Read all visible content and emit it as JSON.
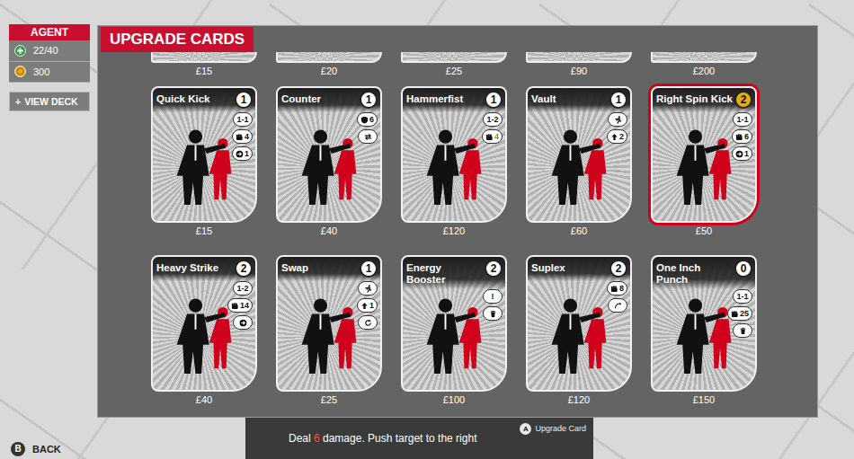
{
  "agent": {
    "title": "AGENT",
    "health": "22/40",
    "money": "300"
  },
  "view_deck": {
    "icon": "+",
    "label": "VIEW DECK"
  },
  "panel": {
    "title": "UPGRADE CARDS"
  },
  "partial_cards": [
    {
      "price": "£15"
    },
    {
      "price": "£20"
    },
    {
      "price": "£25"
    },
    {
      "price": "£90"
    },
    {
      "price": "£200"
    }
  ],
  "cards": [
    {
      "name": "Quick Kick",
      "cost": "1",
      "cost_upgraded": false,
      "price": "£15",
      "selected": false,
      "stats": [
        {
          "kind": "range",
          "value": "1-1",
          "upgraded": false
        },
        {
          "kind": "damage",
          "value": "4",
          "upgraded": false
        },
        {
          "kind": "push",
          "value": "1",
          "upgraded": false
        }
      ]
    },
    {
      "name": "Counter",
      "cost": "1",
      "cost_upgraded": false,
      "price": "£40",
      "selected": false,
      "stats": [
        {
          "kind": "block",
          "value": "6",
          "upgraded": false
        },
        {
          "kind": "swap"
        }
      ]
    },
    {
      "name": "Hammerfist",
      "cost": "1",
      "cost_upgraded": false,
      "price": "£120",
      "selected": false,
      "stats": [
        {
          "kind": "range",
          "value": "1-2",
          "upgraded": false
        },
        {
          "kind": "damage",
          "value": "4",
          "upgraded": true
        }
      ]
    },
    {
      "name": "Vault",
      "cost": "1",
      "cost_upgraded": false,
      "price": "£60",
      "selected": false,
      "stats": [
        {
          "kind": "move"
        },
        {
          "kind": "up",
          "value": "2",
          "upgraded": false
        }
      ]
    },
    {
      "name": "Right Spin Kick",
      "cost": "2",
      "cost_upgraded": true,
      "price": "£50",
      "selected": true,
      "stats": [
        {
          "kind": "range",
          "value": "1-1",
          "upgraded": false
        },
        {
          "kind": "damage",
          "value": "6",
          "upgraded": false
        },
        {
          "kind": "push",
          "value": "1",
          "upgraded": false
        }
      ]
    },
    {
      "name": "Heavy Strike",
      "cost": "2",
      "cost_upgraded": false,
      "price": "£40",
      "selected": false,
      "stats": [
        {
          "kind": "range",
          "value": "1-2",
          "upgraded": false
        },
        {
          "kind": "damage",
          "value": "14",
          "upgraded": false
        },
        {
          "kind": "push"
        }
      ]
    },
    {
      "name": "Swap",
      "cost": "1",
      "cost_upgraded": false,
      "price": "£25",
      "selected": false,
      "stats": [
        {
          "kind": "move"
        },
        {
          "kind": "up",
          "value": "1",
          "upgraded": false
        },
        {
          "kind": "rotate"
        }
      ]
    },
    {
      "name": "Energy Booster",
      "cost": "2",
      "cost_upgraded": false,
      "price": "£100",
      "selected": false,
      "stats": [
        {
          "kind": "text",
          "value": "!",
          "upgraded": false
        },
        {
          "kind": "exhaust"
        }
      ]
    },
    {
      "name": "Suplex",
      "cost": "2",
      "cost_upgraded": false,
      "price": "£120",
      "selected": false,
      "stats": [
        {
          "kind": "damage",
          "value": "8",
          "upgraded": false
        },
        {
          "kind": "throw"
        }
      ]
    },
    {
      "name": "One Inch Punch",
      "cost": "0",
      "cost_upgraded": false,
      "price": "£150",
      "selected": false,
      "stats": [
        {
          "kind": "range",
          "value": "1-1",
          "upgraded": false
        },
        {
          "kind": "damage",
          "value": "25",
          "upgraded": false
        },
        {
          "kind": "exhaust"
        }
      ]
    }
  ],
  "description": {
    "segments": [
      {
        "text": "Deal ",
        "highlight": false
      },
      {
        "text": "6",
        "highlight": true
      },
      {
        "text": " damage. Push target to the right",
        "highlight": false
      }
    ]
  },
  "action_hint": {
    "key": "A",
    "label": "Upgrade Card"
  },
  "back": {
    "key": "B",
    "label": "BACK"
  }
}
